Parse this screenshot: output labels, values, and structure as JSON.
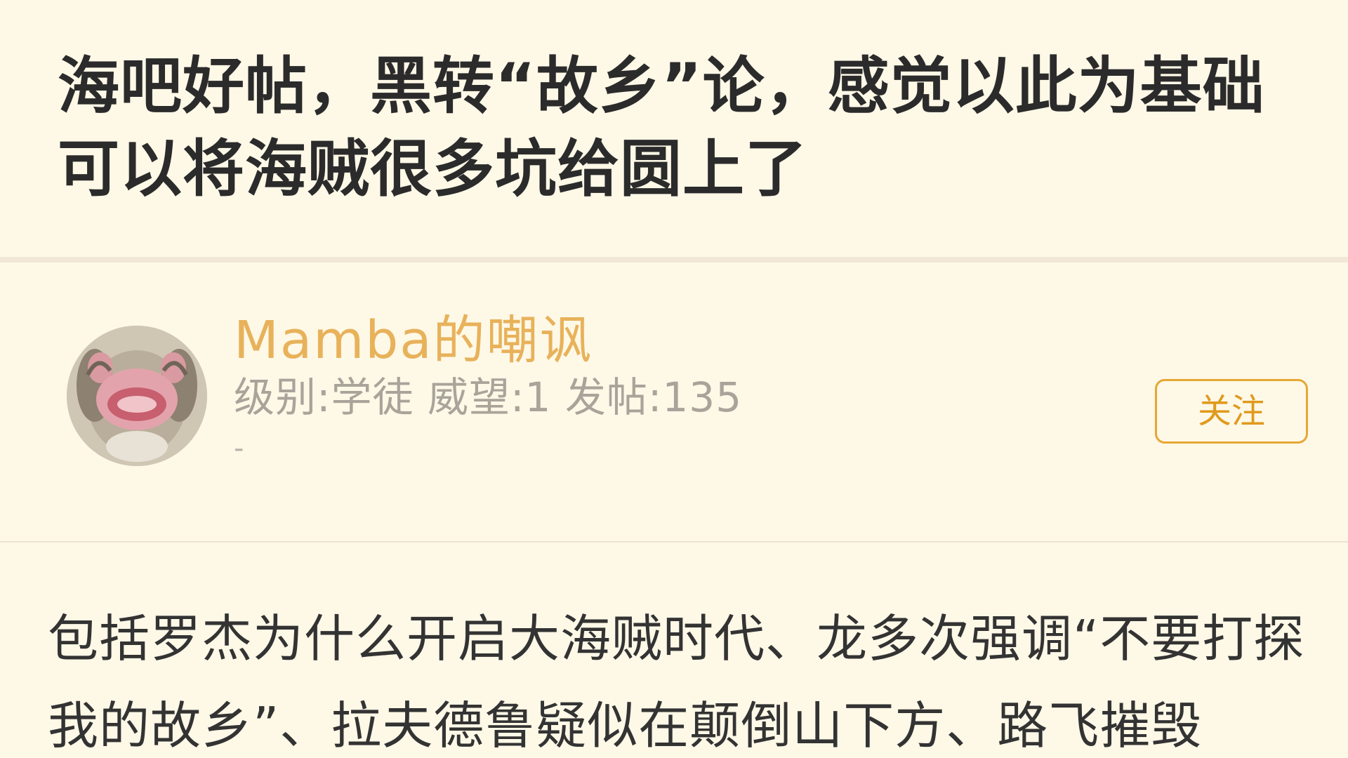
{
  "post": {
    "title": "海吧好帖，黑转“故乡”论，感觉以此为基础可以将海贼很多坑给圆上了",
    "body": "包括罗杰为什么开启大海贼时代、龙多次强调“不要打探我的故乡”、拉夫德鲁疑似在颠倒山下方、路飞摧毁"
  },
  "author": {
    "name": "Mamba的嘲讽",
    "stats": "级别:学徒 威望:1 发帖:135",
    "signature": "-",
    "avatar_icon": "avatar-photo"
  },
  "actions": {
    "follow_label": "关注"
  },
  "colors": {
    "background": "#fef8e7",
    "title_text": "#2b2b2b",
    "author_name": "#e8b25a",
    "meta_text": "#a9a49a",
    "accent": "#e6a834"
  }
}
